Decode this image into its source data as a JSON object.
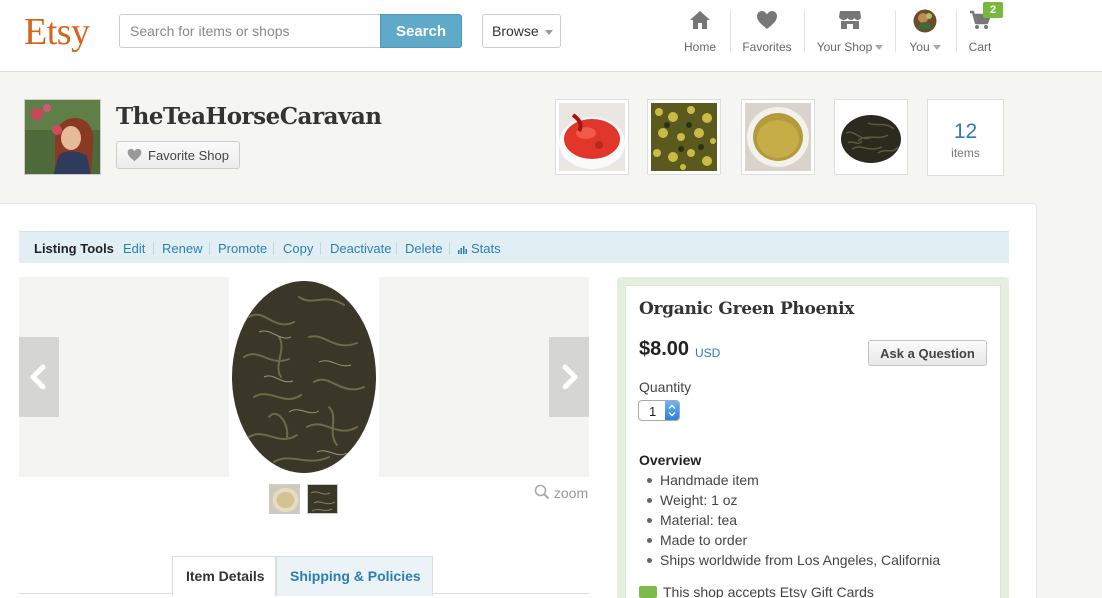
{
  "header": {
    "logo": "Etsy",
    "search_placeholder": "Search for items or shops",
    "search_button": "Search",
    "browse_button": "Browse",
    "nav": {
      "home": "Home",
      "favorites": "Favorites",
      "your_shop": "Your Shop",
      "you": "You",
      "cart": "Cart",
      "cart_count": "2"
    }
  },
  "shop": {
    "name": "TheTeaHorseCaravan",
    "favorite_button": "Favorite Shop",
    "items_count": "12",
    "items_label": "items"
  },
  "listing_tools": {
    "title": "Listing Tools",
    "edit": "Edit",
    "renew": "Renew",
    "promote": "Promote",
    "copy": "Copy",
    "deactivate": "Deactivate",
    "delete": "Delete",
    "stats": "Stats"
  },
  "gallery": {
    "zoom_label": "zoom"
  },
  "tabs": {
    "item_details": "Item Details",
    "shipping_policies": "Shipping & Policies"
  },
  "listing": {
    "title": "Organic Green Phoenix",
    "price": "$8.00",
    "currency": "USD",
    "ask_button": "Ask a Question",
    "quantity_label": "Quantity",
    "quantity_value": "1",
    "overview_title": "Overview",
    "overview_items": [
      "Handmade item",
      "Weight: 1 oz",
      "Material: tea",
      "Made to order",
      "Ships worldwide from Los Angeles, California"
    ],
    "gift_cards": "This shop accepts Etsy Gift Cards"
  },
  "colors": {
    "brand": "#d5641c",
    "search_button": "#5fa9c9",
    "link": "#2a7fb0",
    "cart_badge": "#78b83f",
    "tools_bar": "#e1eff5",
    "buy_box_border": "#e4f0dd"
  }
}
